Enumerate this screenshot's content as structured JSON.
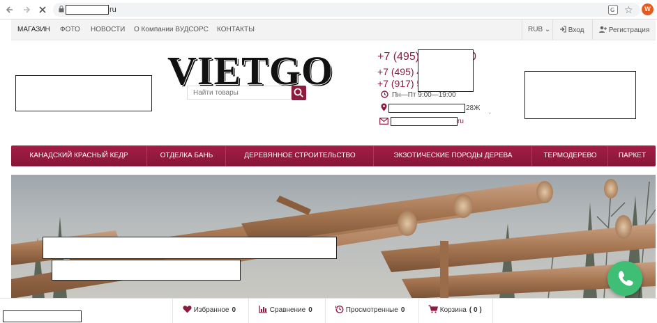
{
  "browser": {
    "url_suffix": "ru",
    "profile_initial": "W"
  },
  "topmenu": {
    "items": [
      "МАГАЗИН",
      "ФОТО",
      "НОВОСТИ",
      "О Компании ВУДСОРС",
      "КОНТАКТЫ"
    ],
    "currency": "RUB",
    "login": "Вход",
    "register": "Регистрация"
  },
  "header": {
    "logo": "VIETGO",
    "search_placeholder": "Найти товары",
    "phones": [
      "+7 (495)",
      "+7 (495) 4",
      "+7 (917) 5"
    ],
    "phone1_tail": "0",
    "hours": "Пн—Пт 9:00—19:00",
    "address_suffix": "28Ж",
    "email_suffix": "ru",
    "dot": "."
  },
  "categories": [
    "Канадский красный кедр",
    "Отделка бань",
    "Деревянное строительство",
    "Экзотические породы дерева",
    "Термодерево",
    "Паркет"
  ],
  "bottombar": {
    "favorites": "Избранное",
    "favorites_count": "0",
    "compare": "Сравнение",
    "compare_count": "0",
    "viewed": "Просмотренные",
    "viewed_count": "0",
    "cart": "Корзина",
    "cart_count": "( 0 )"
  },
  "colors": {
    "brand": "#8e1a3d",
    "call": "#3fbf76"
  }
}
